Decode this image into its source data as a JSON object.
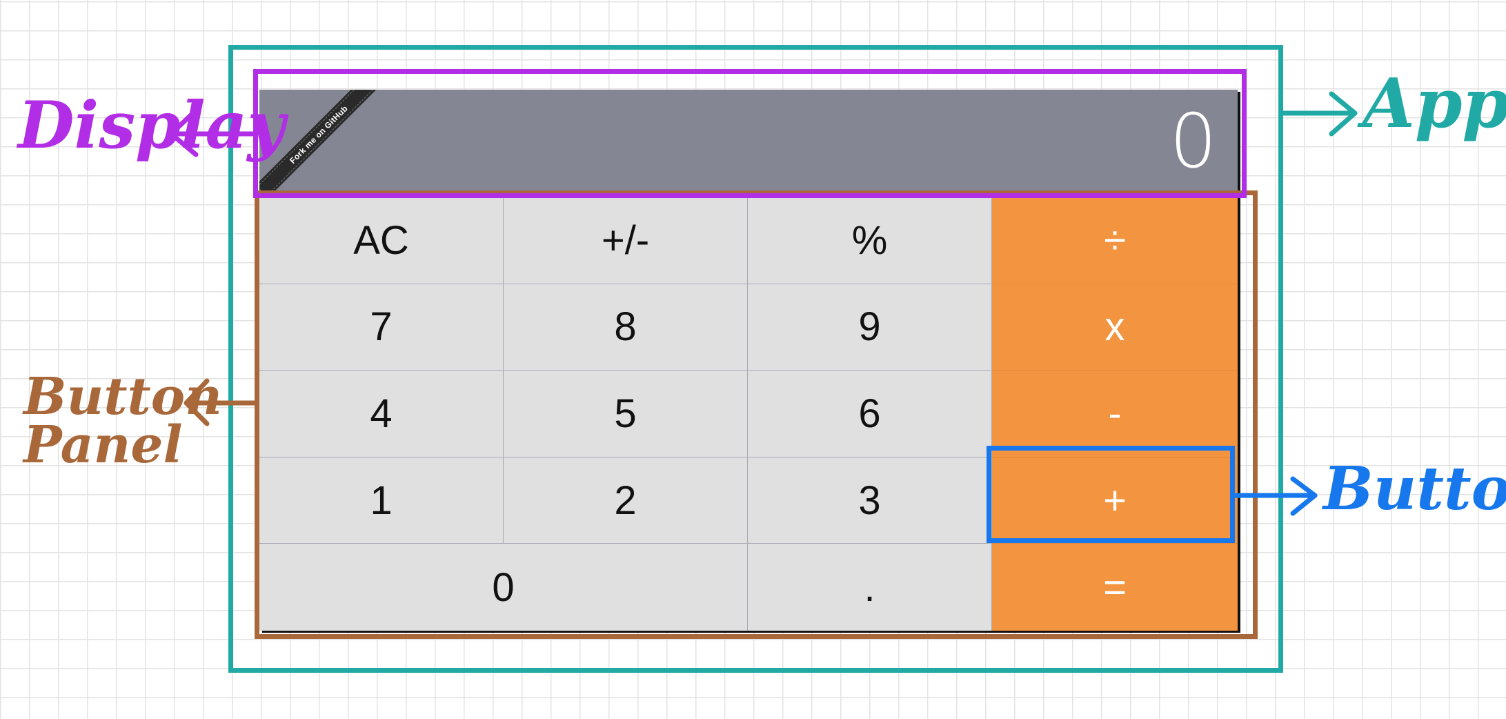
{
  "calculator": {
    "display": {
      "value": "0",
      "ribbon_text": "Fork me on GitHub"
    },
    "buttons": [
      {
        "label": "AC",
        "style": "gray"
      },
      {
        "label": "+/-",
        "style": "gray"
      },
      {
        "label": "%",
        "style": "gray"
      },
      {
        "label": "÷",
        "style": "orange"
      },
      {
        "label": "7",
        "style": "gray"
      },
      {
        "label": "8",
        "style": "gray"
      },
      {
        "label": "9",
        "style": "gray"
      },
      {
        "label": "x",
        "style": "orange"
      },
      {
        "label": "4",
        "style": "gray"
      },
      {
        "label": "5",
        "style": "gray"
      },
      {
        "label": "6",
        "style": "gray"
      },
      {
        "label": "-",
        "style": "orange"
      },
      {
        "label": "1",
        "style": "gray"
      },
      {
        "label": "2",
        "style": "gray"
      },
      {
        "label": "3",
        "style": "gray"
      },
      {
        "label": "+",
        "style": "orange"
      },
      {
        "label": "0",
        "style": "gray"
      },
      {
        "label": ".",
        "style": "gray"
      },
      {
        "label": "=",
        "style": "orange"
      }
    ]
  },
  "annotations": {
    "display": "Display",
    "app": "App",
    "button_panel_line1": "Button",
    "button_panel_line2": "Panel",
    "button": "Button"
  },
  "colors": {
    "display_bg": "#858694",
    "button_gray": "#e0e0e0",
    "button_orange": "#f39540",
    "app_frame": "#21aaa5",
    "display_frame": "#b12de6",
    "panel_frame": "#a8683a",
    "button_frame": "#1678ec"
  }
}
